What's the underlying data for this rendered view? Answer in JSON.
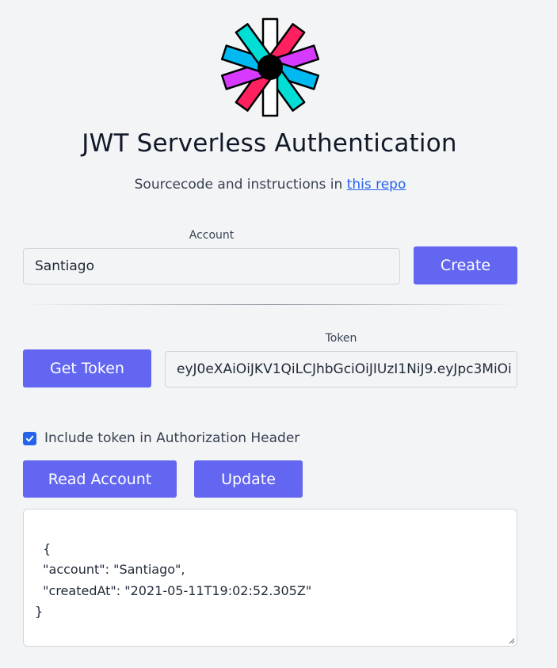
{
  "header": {
    "title": "JWT Serverless Authentication",
    "subtitle_prefix": "Sourcecode and instructions in ",
    "subtitle_link": "this repo",
    "logo_icon": "jwt-logo-icon"
  },
  "account": {
    "label": "Account",
    "value": "Santiago",
    "create_label": "Create"
  },
  "token": {
    "label": "Token",
    "get_label": "Get Token",
    "value": "eyJ0eXAiOiJKV1QiLCJhbGciOiJIUzI1NiJ9.eyJpc3MiOi"
  },
  "options": {
    "include_header_label": "Include token in Authorization Header",
    "include_header_checked": true
  },
  "actions": {
    "read_label": "Read Account",
    "update_label": "Update"
  },
  "output": {
    "text": "{\n  \"account\": \"Santiago\",\n  \"createdAt\": \"2021-05-11T19:02:52.305Z\"\n}"
  },
  "colors": {
    "accent": "#6366f1",
    "link": "#2563eb",
    "background": "#f3f4f6"
  }
}
